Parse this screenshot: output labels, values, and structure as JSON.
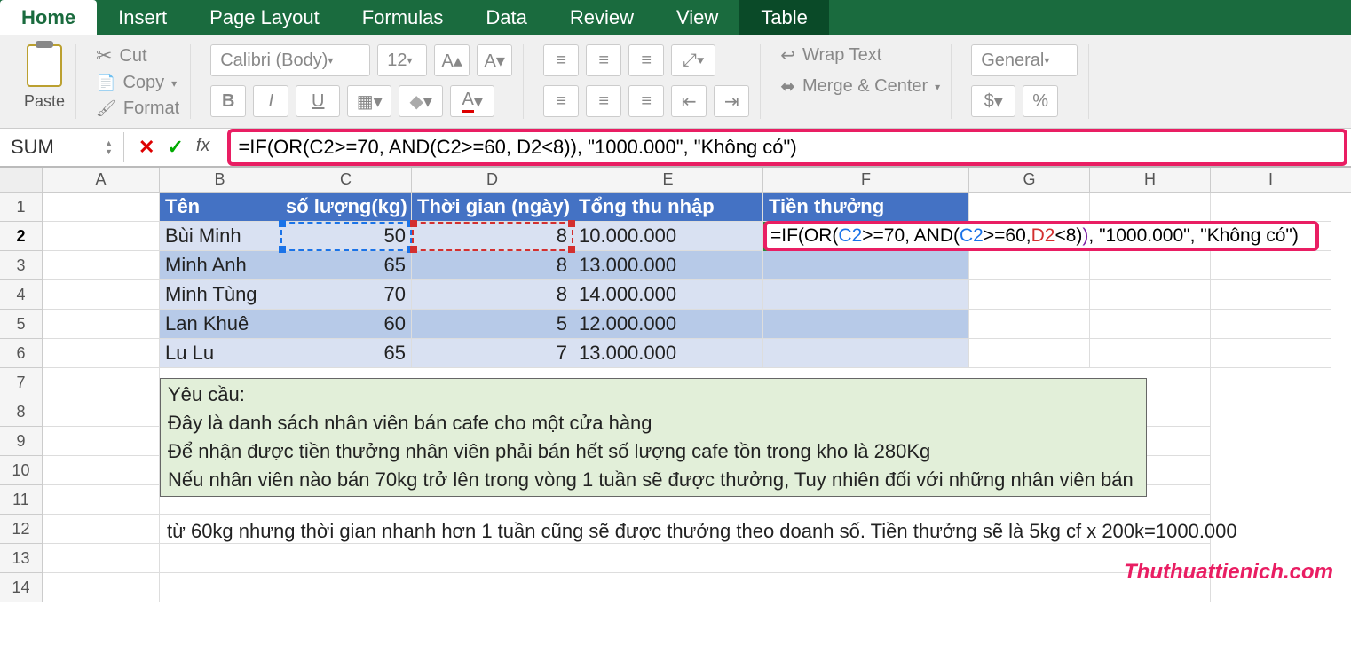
{
  "tabs": [
    "Home",
    "Insert",
    "Page Layout",
    "Formulas",
    "Data",
    "Review",
    "View",
    "Table"
  ],
  "activeTab": 0,
  "clipboard": {
    "paste": "Paste",
    "cut": "Cut",
    "copy": "Copy",
    "format": "Format"
  },
  "font": {
    "name": "Calibri (Body)",
    "size": "12",
    "bold": "B",
    "italic": "I",
    "underline": "U"
  },
  "align": {
    "wrap": "Wrap Text",
    "merge": "Merge & Center"
  },
  "number": {
    "general": "General",
    "currency": "$",
    "percent": "%"
  },
  "nameBox": "SUM",
  "formula": "=IF(OR(C2>=70, AND(C2>=60, D2<8)), \"1000.000\", \"Không có\")",
  "columns": [
    "A",
    "B",
    "C",
    "D",
    "E",
    "F",
    "G",
    "H",
    "I"
  ],
  "rows": [
    "1",
    "2",
    "3",
    "4",
    "5",
    "6",
    "7",
    "8",
    "9",
    "10",
    "11",
    "12",
    "13",
    "14"
  ],
  "tableHeaders": [
    "Tên",
    "số lượng(kg)",
    "Thời gian (ngày)",
    "Tổng thu nhập",
    "Tiền thưởng"
  ],
  "tableData": [
    {
      "ten": "Bùi Minh",
      "sl": "50",
      "tg": "8",
      "tn": "10.000.000"
    },
    {
      "ten": "Minh Anh",
      "sl": "65",
      "tg": "8",
      "tn": "13.000.000"
    },
    {
      "ten": "Minh Tùng",
      "sl": "70",
      "tg": "8",
      "tn": "14.000.000"
    },
    {
      "ten": "Lan Khuê",
      "sl": "60",
      "tg": "5",
      "tn": "12.000.000"
    },
    {
      "ten": "Lu Lu",
      "sl": "65",
      "tg": "7",
      "tn": "13.000.000"
    }
  ],
  "cellFormula": {
    "prefix": "=IF(OR(",
    "c2a": "C2",
    "mid1": ">=70, AND(",
    "c2b": "C2",
    "mid2": ">=60, ",
    "d2": "D2",
    "mid3": "<8)",
    "close": ")",
    "suffix": ", \"1000.000\", \"Không có\")"
  },
  "note": {
    "title": "Yêu cầu:",
    "l1": "Đây là danh sách nhân viên bán cafe cho một cửa hàng",
    "l2": "Để nhận được tiền thưởng nhân viên phải bán hết số lượng cafe tồn trong kho là 280Kg",
    "l3": "Nếu nhân viên nào bán 70kg trở lên trong vòng 1 tuần sẽ được thưởng, Tuy nhiên đối với những nhân viên bán",
    "l4": "từ 60kg nhưng thời gian nhanh hơn 1 tuần cũng sẽ được thưởng theo doanh số. Tiền thưởng sẽ là 5kg cf x 200k=1000.000"
  },
  "watermark": "Thuthuattienich.com"
}
